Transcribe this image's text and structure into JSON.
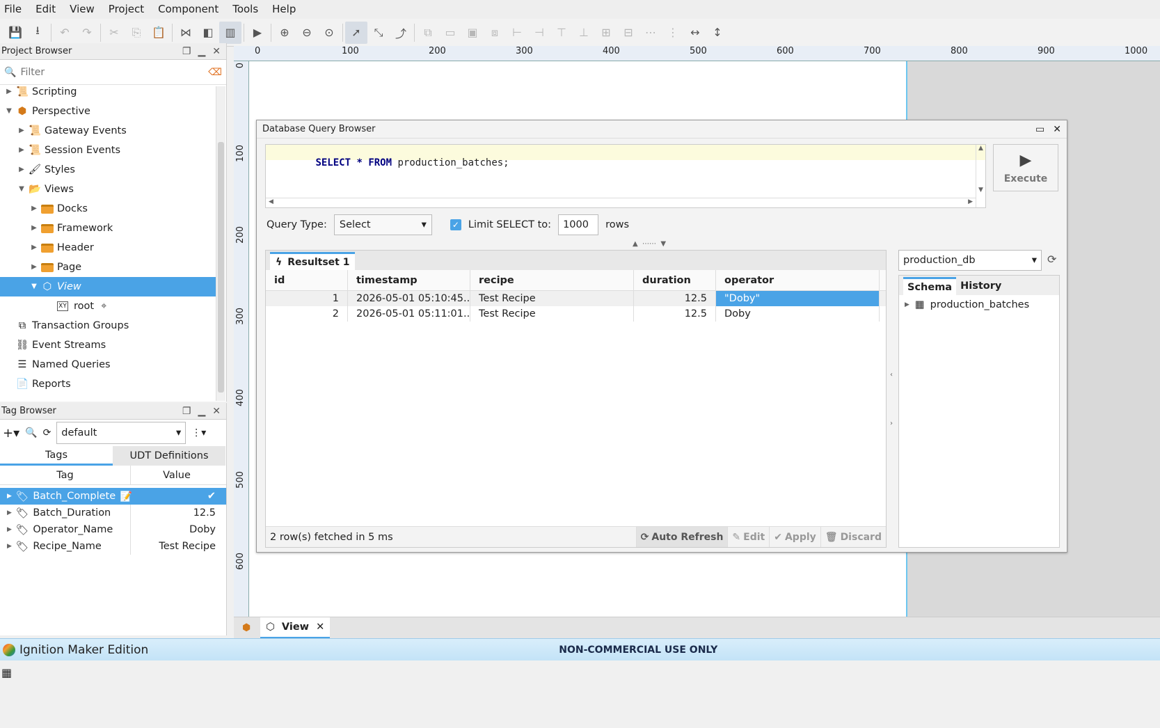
{
  "menu": [
    "File",
    "Edit",
    "View",
    "Project",
    "Component",
    "Tools",
    "Help"
  ],
  "project_browser": {
    "title": "Project Browser",
    "filter_placeholder": "Filter",
    "items": [
      {
        "label": "Scripting"
      },
      {
        "label": "Perspective"
      },
      {
        "label": "Gateway Events"
      },
      {
        "label": "Session Events"
      },
      {
        "label": "Styles"
      },
      {
        "label": "Views"
      },
      {
        "label": "Docks"
      },
      {
        "label": "Framework"
      },
      {
        "label": "Header"
      },
      {
        "label": "Page"
      },
      {
        "label": "View"
      },
      {
        "label": "root"
      },
      {
        "label": "Transaction Groups"
      },
      {
        "label": "Event Streams"
      },
      {
        "label": "Named Queries"
      },
      {
        "label": "Reports"
      }
    ]
  },
  "tag_browser": {
    "title": "Tag Browser",
    "provider": "default",
    "tabs": [
      "Tags",
      "UDT Definitions"
    ],
    "columns": [
      "Tag",
      "Value"
    ],
    "rows": [
      {
        "tag": "Batch_Complete",
        "value": "✔"
      },
      {
        "tag": "Batch_Duration",
        "value": "12.5"
      },
      {
        "tag": "Operator_Name",
        "value": "Doby"
      },
      {
        "tag": "Recipe_Name",
        "value": "Test Recipe"
      }
    ]
  },
  "rulers": {
    "h": [
      "0",
      "100",
      "200",
      "300",
      "400",
      "500",
      "600",
      "700",
      "800",
      "900",
      "1000"
    ],
    "v": [
      "0",
      "100",
      "200",
      "300",
      "400",
      "500",
      "600"
    ]
  },
  "dqb": {
    "title": "Database Query Browser",
    "query_kw1": "SELECT",
    "query_star": " * ",
    "query_kw2": "FROM",
    "query_rest": " production_batches;",
    "execute": "Execute",
    "query_type_label": "Query Type:",
    "query_type_value": "Select",
    "limit_label": "Limit SELECT to:",
    "limit_value": "1000",
    "rows_label": "rows",
    "resultset_tab": "Resultset 1",
    "columns": [
      "id",
      "timestamp",
      "recipe",
      "duration",
      "operator"
    ],
    "rows": [
      {
        "id": "1",
        "timestamp": "2026-05-01 05:10:45....",
        "recipe": "Test Recipe",
        "duration": "12.5",
        "operator": "\"Doby\""
      },
      {
        "id": "2",
        "timestamp": "2026-05-01 05:11:01....",
        "recipe": "Test Recipe",
        "duration": "12.5",
        "operator": "Doby"
      }
    ],
    "status": "2 row(s) fetched in 5 ms",
    "auto_refresh": "Auto Refresh",
    "edit": "Edit",
    "apply": "Apply",
    "discard": "Discard",
    "database": "production_db",
    "schema_tab": "Schema",
    "history_tab": "History",
    "schema_item": "production_batches"
  },
  "doc_tab": {
    "label": "View"
  },
  "status": {
    "edition": "Ignition Maker Edition",
    "notice": "NON-COMMERCIAL USE ONLY"
  }
}
